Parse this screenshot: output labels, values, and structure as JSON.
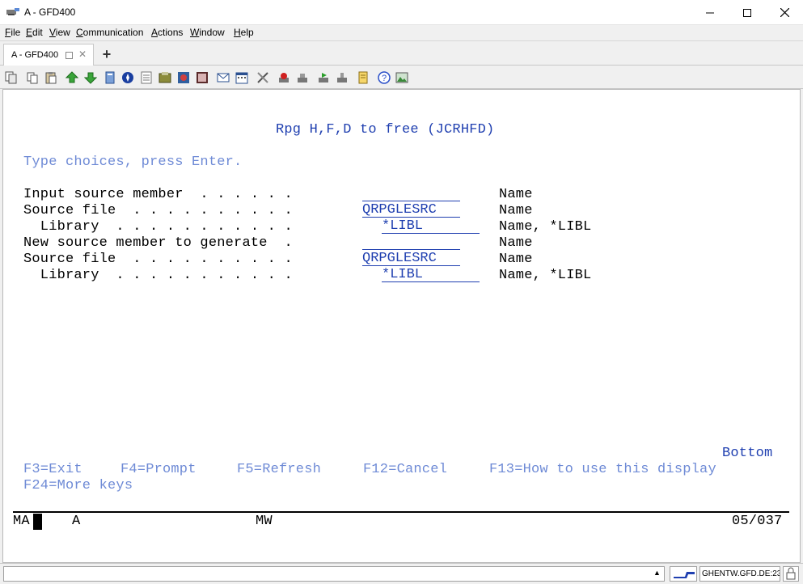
{
  "window": {
    "title": "A - GFD400"
  },
  "menu": [
    {
      "label": "File",
      "accel": "F",
      "rest": "ile"
    },
    {
      "label": "Edit",
      "accel": "E",
      "rest": "dit"
    },
    {
      "label": "View",
      "accel": "V",
      "rest": "iew"
    },
    {
      "label": "Communication",
      "accel": "C",
      "rest": "ommunication"
    },
    {
      "label": "Actions",
      "accel": "A",
      "rest": "ctions"
    },
    {
      "label": "Window",
      "accel": "W",
      "rest": "indow"
    },
    {
      "label": "Help",
      "accel": "H",
      "rest": "elp"
    }
  ],
  "tabs": [
    {
      "label": "A - GFD400"
    }
  ],
  "add_tab": "+",
  "toolbar_icons": [
    "copy-icon",
    "cut-icon",
    "paste-icon",
    "send-icon",
    "receive-icon",
    "macro-icon",
    "compass-icon",
    "notes-icon",
    "archive-icon",
    "settings-icon",
    "record-icon",
    "mail-icon",
    "calendar-icon",
    "tools-icon",
    "stop-icon",
    "disk-icon",
    "play-icon",
    "disk2-icon",
    "notepad-icon",
    "help-icon",
    "image-icon"
  ],
  "screen": {
    "title": "Rpg H,F,D to free (JCRHFD)",
    "instruction": "Type choices, press Enter.",
    "rows": [
      {
        "label": "Input source member  . . . . . .",
        "value": "",
        "hint": "Name"
      },
      {
        "label": "Source file  . . . . . . . . . .",
        "value": "QRPGLESRC",
        "hint": "Name"
      },
      {
        "label": "  Library  . . . . . . . . . . .",
        "value": "*LIBL",
        "hint": "Name, *LIBL"
      },
      {
        "label": "New source member to generate  .",
        "value": "",
        "hint": "Name"
      },
      {
        "label": "Source file  . . . . . . . . . .",
        "value": "QRPGLESRC",
        "hint": "Name"
      },
      {
        "label": "  Library  . . . . . . . . . . .",
        "value": "*LIBL",
        "hint": "Name, *LIBL"
      }
    ],
    "bottom": "Bottom",
    "fkeys_line1": [
      "F3=Exit",
      "F4=Prompt",
      "F5=Refresh",
      "F12=Cancel",
      "F13=How to use this display"
    ],
    "fkeys_line2": "F24=More keys",
    "oia": {
      "left": "MA",
      "session": "A",
      "mode": "MW",
      "position": "05/037"
    }
  },
  "statusbar": {
    "host": "GHENTW.GFD.DE:23"
  }
}
